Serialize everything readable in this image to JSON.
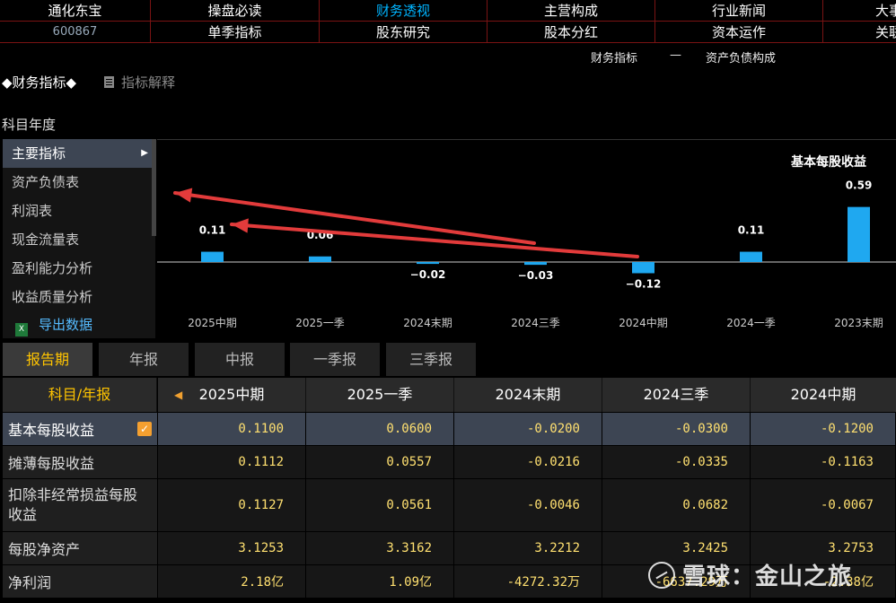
{
  "stock": {
    "name": "通化东宝",
    "code": "600867"
  },
  "nav": {
    "row1": [
      "操盘必读",
      "财务透视",
      "主营构成",
      "行业新闻",
      "大事提醒"
    ],
    "row2": [
      "单季指标",
      "股东研究",
      "股本分红",
      "资本运作",
      "关联个股"
    ]
  },
  "subhead": {
    "left": "财务指标",
    "dash": "—",
    "right": "资产负债构成"
  },
  "section_title": "◆财务指标◆",
  "explain_label": "指标解释",
  "year_label": "科目年度",
  "menu": [
    "主要指标",
    "资产负债表",
    "利润表",
    "现金流量表",
    "盈利能力分析",
    "收益质量分析"
  ],
  "export_label": "导出数据",
  "tabs": [
    "报告期",
    "年报",
    "中报",
    "一季报",
    "三季报"
  ],
  "table": {
    "header_first": "科目/年报",
    "columns": [
      "2025中期",
      "2025一季",
      "2024末期",
      "2024三季",
      "2024中期"
    ],
    "rows": [
      {
        "label": "基本每股收益",
        "values": [
          "0.1100",
          "0.0600",
          "-0.0200",
          "-0.0300",
          "-0.1200"
        ]
      },
      {
        "label": "摊薄每股收益",
        "values": [
          "0.1112",
          "0.0557",
          "-0.0216",
          "-0.0335",
          "-0.1163"
        ]
      },
      {
        "label": "扣除非经常损益每股收益",
        "values": [
          "0.1127",
          "0.0561",
          "-0.0046",
          "0.0682",
          "-0.0067"
        ]
      },
      {
        "label": "每股净资产",
        "values": [
          "3.1253",
          "3.3162",
          "3.2212",
          "3.2425",
          "3.2753"
        ]
      },
      {
        "label": "净利润",
        "values": [
          "2.18亿",
          "1.09亿",
          "-4272.32万",
          "-6637.29万",
          "-2.38亿"
        ]
      }
    ]
  },
  "chart_data": {
    "type": "bar",
    "title": "基本每股收益",
    "categories": [
      "2025中期",
      "2025一季",
      "2024末期",
      "2024三季",
      "2024中期",
      "2024一季",
      "2023末期"
    ],
    "values": [
      0.11,
      0.06,
      -0.02,
      -0.03,
      -0.12,
      0.11,
      0.59
    ],
    "labels": [
      "0.11",
      "0.06",
      "−0.02",
      "−0.03",
      "−0.12",
      "0.11",
      "0.59"
    ],
    "bar_color": "#1fa8f0",
    "grid": false
  },
  "watermark": "雪球：金山之旅"
}
